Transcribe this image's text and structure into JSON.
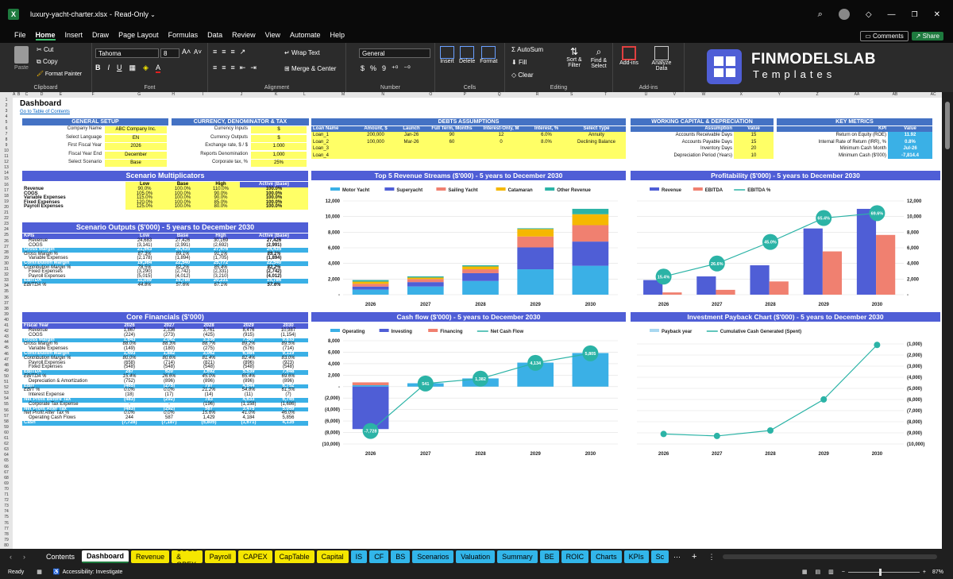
{
  "app": {
    "filename": "luxury-yacht-charter.xlsx",
    "mode": "Read-Only"
  },
  "menu": [
    "File",
    "Home",
    "Insert",
    "Draw",
    "Page Layout",
    "Formulas",
    "Data",
    "Review",
    "View",
    "Automate",
    "Help"
  ],
  "active_menu": "Home",
  "right_buttons": {
    "comments": "Comments",
    "share": "Share"
  },
  "ribbon": {
    "clipboard": {
      "paste": "Paste",
      "cut": "Cut",
      "copy": "Copy",
      "format_painter": "Format Painter",
      "label": "Clipboard"
    },
    "font": {
      "name": "Tahoma",
      "size": "8",
      "label": "Font"
    },
    "alignment": {
      "wrap": "Wrap Text",
      "merge": "Merge & Center",
      "label": "Alignment"
    },
    "number": {
      "format": "General",
      "label": "Number"
    },
    "cells": {
      "insert": "Insert",
      "delete": "Delete",
      "format": "Format",
      "label": "Cells"
    },
    "editing": {
      "autosum": "AutoSum",
      "fill": "Fill",
      "clear": "Clear",
      "sort": "Sort & Filter",
      "find": "Find & Select",
      "label": "Editing"
    },
    "addins": {
      "addins": "Add-ins",
      "analyze": "Analyze Data",
      "label": "Add-ins"
    }
  },
  "logo": {
    "line1": "FINMODELSLAB",
    "line2": "Templates"
  },
  "columns": [
    "A",
    "B",
    "C",
    "D",
    "E",
    "F",
    "G",
    "H",
    "I",
    "J",
    "K",
    "L",
    "M",
    "N",
    "O",
    "P",
    "Q",
    "R",
    "S",
    "T",
    "U",
    "V",
    "W",
    "X",
    "Y",
    "Z",
    "AA",
    "AB",
    "AC",
    "AD"
  ],
  "dashboard": {
    "title": "Dashboard",
    "toc": "Go to Table of Contents",
    "general_setup": {
      "title": "GENERAL SETUP",
      "rows": [
        [
          "Company Name",
          "ABC Company Inc."
        ],
        [
          "Select Language",
          "EN"
        ],
        [
          "First Fiscal Year",
          "2026"
        ],
        [
          "Fiscal Year End",
          "December"
        ],
        [
          "Select Scenario",
          "Base"
        ]
      ]
    },
    "currency": {
      "title": "CURRENCY, DENOMINATOR & TAX",
      "rows": [
        [
          "Currency Inputs",
          "$"
        ],
        [
          "Currency Outputs",
          "$"
        ],
        [
          "Exchange rate, $ / $",
          "1.000"
        ],
        [
          "Reports Denomination",
          "1,000"
        ],
        [
          "Corporate tax, %",
          "25%"
        ]
      ]
    },
    "debts": {
      "title": "DEBTS ASSUMPTIONS",
      "headers": [
        "Loan Name",
        "Amount, $",
        "Launch",
        "Full Term, Months",
        "Interest-Only, M",
        "Interest, %",
        "Select Type"
      ],
      "rows": [
        [
          "Loan_1",
          "200,000",
          "Jan-26",
          "90",
          "12",
          "6.0%",
          "Annuity"
        ],
        [
          "Loan_2",
          "100,000",
          "Mar-26",
          "60",
          "0",
          "8.0%",
          "Declining Balance"
        ],
        [
          "Loan_3",
          "",
          "",
          "",
          "",
          "",
          ""
        ],
        [
          "Loan_4",
          "",
          "",
          "",
          "",
          "",
          ""
        ]
      ]
    },
    "working": {
      "title": "WORKING CAPITAL & DEPRECIATION",
      "headers": [
        "Assumption",
        "Value"
      ],
      "rows": [
        [
          "Accounts Receivable Days",
          "15"
        ],
        [
          "Accounts Payable Days",
          "15"
        ],
        [
          "Inventory Days",
          "20"
        ],
        [
          "Depreciation Period (Years)",
          "10"
        ]
      ]
    },
    "key_metrics": {
      "title": "KEY METRICS",
      "headers": [
        "KPI",
        "Value"
      ],
      "rows": [
        [
          "Return on Equity (ROE)",
          "11.92"
        ],
        [
          "Internal Rate of Return (IRR), %",
          "0.8%"
        ],
        [
          "Minimum Cash Month",
          "Jul-26"
        ],
        [
          "Minimum Cash ($'000)",
          "-7,814.4"
        ]
      ]
    },
    "multipliers": {
      "title": "Scenario Multiplicators",
      "headers": [
        "Scenarios",
        "Low",
        "Base",
        "High",
        "Active (Base)"
      ],
      "rows": [
        [
          "Revenue",
          "90.0%",
          "100.0%",
          "110.0%",
          "100.0%"
        ],
        [
          "COGS",
          "105.0%",
          "100.0%",
          "90.0%",
          "100.0%"
        ],
        [
          "Variable Expenses",
          "115.0%",
          "100.0%",
          "90.0%",
          "100.0%"
        ],
        [
          "Fixed Expenses",
          "120.0%",
          "100.0%",
          "85.0%",
          "100.0%"
        ],
        [
          "Payroll Expenses",
          "125.0%",
          "100.0%",
          "80.0%",
          "100.0%"
        ]
      ]
    },
    "scenario_outputs": {
      "title": "Scenario Outputs ($'000) - 5 years to December 2030",
      "headers": [
        "KPIs",
        "Low",
        "Base",
        "High",
        "Active (Base)"
      ],
      "rows": [
        {
          "c": [
            "Revenue",
            "24,683",
            "27,426",
            "30,169",
            "27,426"
          ],
          "s": ""
        },
        {
          "c": [
            "COGS",
            "(3,141)",
            "(2,991)",
            "(2,692)",
            "(2,991)"
          ],
          "s": ""
        },
        {
          "c": [
            "Gross Margin",
            "21,543",
            "24,435",
            "27,476",
            "24,435"
          ],
          "s": "hl"
        },
        {
          "c": [
            "Gross Margin %",
            "87.3%",
            "89.1%",
            "91.1%",
            "89.1%"
          ],
          "s": "it"
        },
        {
          "c": [
            "Variable Expenses",
            "(2,178)",
            "(1,894)",
            "(1,705)",
            "(1,894)"
          ],
          "s": ""
        },
        {
          "c": [
            "Contribution Margin",
            "19,364",
            "22,540",
            "25,772",
            "22,540"
          ],
          "s": "hl"
        },
        {
          "c": [
            "Contribution Margin %",
            "78.5%",
            "82.2%",
            "85.4%",
            "82.2%"
          ],
          "s": "it"
        },
        {
          "c": [
            "Fixed Expenses",
            "(3,290)",
            "(2,742)",
            "(2,331)",
            "(2,742)"
          ],
          "s": ""
        },
        {
          "c": [
            "Payroll Expenses",
            "(5,015)",
            "(4,012)",
            "(3,210)",
            "(4,012)"
          ],
          "s": ""
        },
        {
          "c": [
            "EBITDA",
            "11,059",
            "15,786",
            "20,231",
            "15,786"
          ],
          "s": "hl"
        },
        {
          "c": [
            "EBITDA %",
            "44.8%",
            "57.6%",
            "67.1%",
            "57.6%"
          ],
          "s": "it"
        }
      ]
    },
    "core": {
      "title": "Core Financials ($'000)",
      "headers": [
        "Fiscal Year",
        "2026",
        "2027",
        "2028",
        "2029",
        "2030"
      ],
      "rows": [
        {
          "c": [
            "Revenue",
            "1,867",
            "2,336",
            "3,761",
            "8,476",
            "10,987"
          ],
          "s": ""
        },
        {
          "c": [
            "COGS",
            "(224)",
            "(273)",
            "(425)",
            "(915)",
            "(1,154)"
          ],
          "s": ""
        },
        {
          "c": [
            "Gross Margin",
            "1,643",
            "2,062",
            "3,336",
            "7,560",
            "9,833"
          ],
          "s": "hl"
        },
        {
          "c": [
            "Gross Margin %",
            "88.0%",
            "88.3%",
            "88.7%",
            "89.2%",
            "89.5%"
          ],
          "s": "it"
        },
        {
          "c": [
            "Variable Expenses",
            "(149)",
            "(180)",
            "(275)",
            "(576)",
            "(714)"
          ],
          "s": ""
        },
        {
          "c": [
            "Contribution Margin",
            "1,493",
            "1,882",
            "3,062",
            "6,984",
            "9,119"
          ],
          "s": "hl"
        },
        {
          "c": [
            "Contribution Margin %",
            "80.0%",
            "80.6%",
            "81.4%",
            "82.4%",
            "83.0%"
          ],
          "s": "it"
        },
        {
          "c": [
            "Payroll Expenses",
            "(658)",
            "(714)",
            "(821)",
            "(896)",
            "(923)"
          ],
          "s": ""
        },
        {
          "c": [
            "Fixed Expenses",
            "(548)",
            "(548)",
            "(548)",
            "(548)",
            "(548)"
          ],
          "s": ""
        },
        {
          "c": [
            "EBITDA",
            "287",
            "620",
            "1,692",
            "5,539",
            "7,648"
          ],
          "s": "hl"
        },
        {
          "c": [
            "EBITDA %",
            "15.4%",
            "26.6%",
            "45.0%",
            "65.4%",
            "69.6%"
          ],
          "s": "it"
        },
        {
          "c": [
            "Depreciation & Amortization",
            "(752)",
            "(896)",
            "(896)",
            "(896)",
            "(896)"
          ],
          "s": ""
        },
        {
          "c": [
            "EBIT",
            "(465)",
            "(275)",
            "797",
            "4,644",
            "6,752"
          ],
          "s": "hl"
        },
        {
          "c": [
            "EBIT %",
            "0.0%",
            "0.0%",
            "21.2%",
            "54.8%",
            "61.5%"
          ],
          "s": "it"
        },
        {
          "c": [
            "Interest Expense",
            "(18)",
            "(17)",
            "(14)",
            "(11)",
            "(7)"
          ],
          "s": ""
        },
        {
          "c": [
            "Net Profit Before Tax",
            "(483)",
            "(292)",
            "783",
            "4,633",
            "6,745"
          ],
          "s": "hl"
        },
        {
          "c": [
            "Corporate Tax Expense",
            "-",
            "-",
            "(196)",
            "(1,158)",
            "(1,686)"
          ],
          "s": ""
        },
        {
          "c": [
            "Net Profit After Tax",
            "(483)",
            "(292)",
            "587",
            "3,475",
            "5,059"
          ],
          "s": "hl"
        },
        {
          "c": [
            "Net Profit After Tax %",
            "0.0%",
            "0.0%",
            "15.6%",
            "41.0%",
            "46.0%"
          ],
          "s": "it"
        },
        {
          "c": [
            "Operating Cash Flows",
            "244",
            "587",
            "1,429",
            "4,184",
            "5,856"
          ],
          "s": ""
        },
        {
          "c": [
            "Cash",
            "(7,728)",
            "(7,187)",
            "(5,805)",
            "(1,671)",
            "4,135"
          ],
          "s": "hl"
        }
      ]
    }
  },
  "chart_data": [
    {
      "type": "bar",
      "title": "Top 5 Revenue Streams ($'000) - 5 years to December 2030",
      "categories": [
        "2026",
        "2027",
        "2028",
        "2029",
        "2030"
      ],
      "ylim": [
        0,
        12000
      ],
      "yticks": [
        "-",
        "2,000",
        "4,000",
        "6,000",
        "8,000",
        "10,000",
        "12,000"
      ],
      "series": [
        {
          "name": "Motor Yacht",
          "color": "#3ab0e6",
          "values": [
            650,
            1050,
            1750,
            3250,
            3700
          ]
        },
        {
          "name": "Superyacht",
          "color": "#4f5ed6",
          "values": [
            380,
            560,
            1000,
            2800,
            3100
          ]
        },
        {
          "name": "Sailing Yacht",
          "color": "#f08070",
          "values": [
            360,
            390,
            500,
            1400,
            2100
          ]
        },
        {
          "name": "Catamaran",
          "color": "#f5b800",
          "values": [
            280,
            190,
            360,
            950,
            1400
          ]
        },
        {
          "name": "Other Revenue",
          "color": "#2bb3a6",
          "values": [
            200,
            150,
            150,
            100,
            690
          ]
        }
      ]
    },
    {
      "type": "bar",
      "title": "Profitability ($'000) - 5 years to December 2030",
      "categories": [
        "2026",
        "2027",
        "2028",
        "2029",
        "2030"
      ],
      "ylim": [
        0,
        12000
      ],
      "yticks": [
        "-",
        "2,000",
        "4,000",
        "6,000",
        "8,000",
        "10,000",
        "12,000"
      ],
      "series": [
        {
          "name": "Revenue",
          "color": "#4f5ed6",
          "values": [
            1867,
            2336,
            3761,
            8476,
            10987
          ]
        },
        {
          "name": "EBITDA",
          "color": "#f08070",
          "values": [
            287,
            620,
            1692,
            5539,
            7648
          ]
        },
        {
          "name": "EBITDA %",
          "color": "#2bb3a6",
          "values": [
            15.4,
            26.6,
            45.0,
            65.4,
            69.6
          ],
          "labels": [
            "15.4%",
            "26.6%",
            "45.0%",
            "65.4%",
            "69.6%"
          ]
        }
      ]
    },
    {
      "type": "bar",
      "title": "Cash flow ($'000) - 5 years to December 2030",
      "categories": [
        "2026",
        "2027",
        "2028",
        "2029",
        "2030"
      ],
      "ylim": [
        -10000,
        8000
      ],
      "yticks": [
        "(10,000)",
        "(8,000)",
        "(6,000)",
        "(4,000)",
        "(2,000)",
        "-",
        "2,000",
        "4,000",
        "6,000",
        "8,000"
      ],
      "series": [
        {
          "name": "Operating",
          "color": "#3ab0e6",
          "values": [
            244,
            587,
            1429,
            4184,
            5856
          ]
        },
        {
          "name": "Investing",
          "color": "#4f5ed6",
          "values": [
            -7400,
            0,
            0,
            0,
            0
          ]
        },
        {
          "name": "Financing",
          "color": "#f08070",
          "values": [
            500,
            0,
            0,
            0,
            0
          ]
        },
        {
          "name": "Net Cash Flow",
          "color": "#2bb3a6",
          "values": [
            -7728,
            541,
            1382,
            4134,
            5805
          ],
          "labels": [
            "-7,728",
            "541",
            "1,382",
            "4,134",
            "5,805"
          ]
        }
      ]
    },
    {
      "type": "line",
      "title": "Investment Payback Chart ($'000) - 5 years to December 2030",
      "categories": [
        "2026",
        "2027",
        "2028",
        "2029",
        "2030"
      ],
      "ylim": [
        -10000,
        0
      ],
      "yticks": [
        "(10,000)",
        "(9,000)",
        "(8,000)",
        "(7,000)",
        "(6,000)",
        "(5,000)",
        "(4,000)",
        "(3,000)",
        "(2,000)",
        "(1,000)"
      ],
      "series": [
        {
          "name": "Payback year",
          "color": "#a8d8f0",
          "values": []
        },
        {
          "name": "Cumulative Cash Generated (Spent)",
          "color": "#2bb3a6",
          "values": [
            -9000,
            -9200,
            -8650,
            -5550,
            -100
          ]
        }
      ]
    }
  ],
  "sheet_tabs": {
    "active": "Dashboard",
    "items": [
      {
        "l": "Contents",
        "c": "w"
      },
      {
        "l": "Dashboard",
        "c": "a"
      },
      {
        "l": "Revenue",
        "c": "y"
      },
      {
        "l": "COGS & OPEX",
        "c": "y"
      },
      {
        "l": "Payroll",
        "c": "y"
      },
      {
        "l": "CAPEX",
        "c": "y"
      },
      {
        "l": "CapTable",
        "c": "y"
      },
      {
        "l": "Capital",
        "c": "y"
      },
      {
        "l": "IS",
        "c": "b"
      },
      {
        "l": "CF",
        "c": "b"
      },
      {
        "l": "BS",
        "c": "b"
      },
      {
        "l": "Scenarios",
        "c": "b"
      },
      {
        "l": "Valuation",
        "c": "b"
      },
      {
        "l": "Summary",
        "c": "b"
      },
      {
        "l": "BE",
        "c": "b"
      },
      {
        "l": "ROIC",
        "c": "b"
      },
      {
        "l": "Charts",
        "c": "b"
      },
      {
        "l": "KPIs",
        "c": "b"
      },
      {
        "l": "Sc",
        "c": "b"
      }
    ]
  },
  "status": {
    "ready": "Ready",
    "accessibility": "Accessibility: Investigate",
    "zoom": "87%"
  }
}
